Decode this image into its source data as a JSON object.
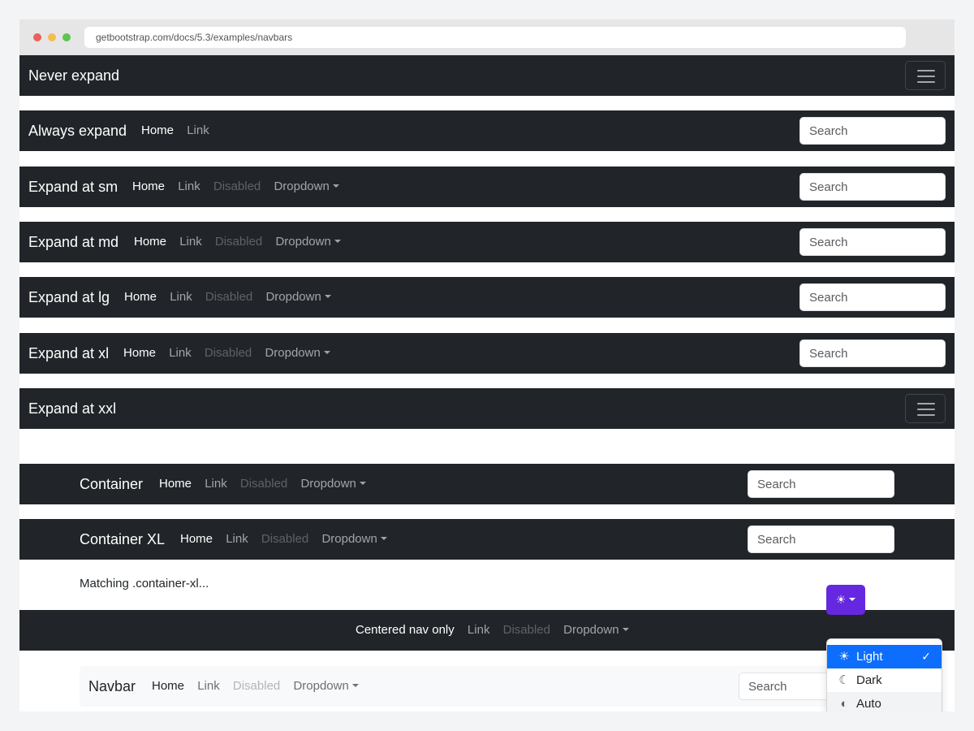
{
  "browser": {
    "url": "getbootstrap.com/docs/5.3/examples/navbars"
  },
  "nav_common": {
    "home": "Home",
    "link": "Link",
    "disabled": "Disabled",
    "dropdown": "Dropdown",
    "search_placeholder": "Search"
  },
  "navbars": {
    "never_expand": {
      "brand": "Never expand"
    },
    "always_expand": {
      "brand": "Always expand"
    },
    "expand_sm": {
      "brand": "Expand at sm"
    },
    "expand_md": {
      "brand": "Expand at md"
    },
    "expand_lg": {
      "brand": "Expand at lg"
    },
    "expand_xl": {
      "brand": "Expand at xl"
    },
    "expand_xxl": {
      "brand": "Expand at xxl"
    },
    "container": {
      "brand": "Container"
    },
    "container_xl": {
      "brand": "Container XL"
    },
    "centered": {
      "label": "Centered nav only"
    },
    "light": {
      "brand": "Navbar"
    }
  },
  "matching_text": "Matching .container-xl...",
  "theme_menu": {
    "button_icon": "sun-icon",
    "items": [
      {
        "label": "Light",
        "icon": "sun-icon",
        "active": true
      },
      {
        "label": "Dark",
        "icon": "moon-stars-icon",
        "active": false
      },
      {
        "label": "Auto",
        "icon": "circle-half-icon",
        "active": false
      }
    ],
    "accent": "#6528e0",
    "active_color": "#0d6efd"
  },
  "colors": {
    "navbar_dark": "#212529",
    "navbar_light": "#f8f9fa"
  }
}
